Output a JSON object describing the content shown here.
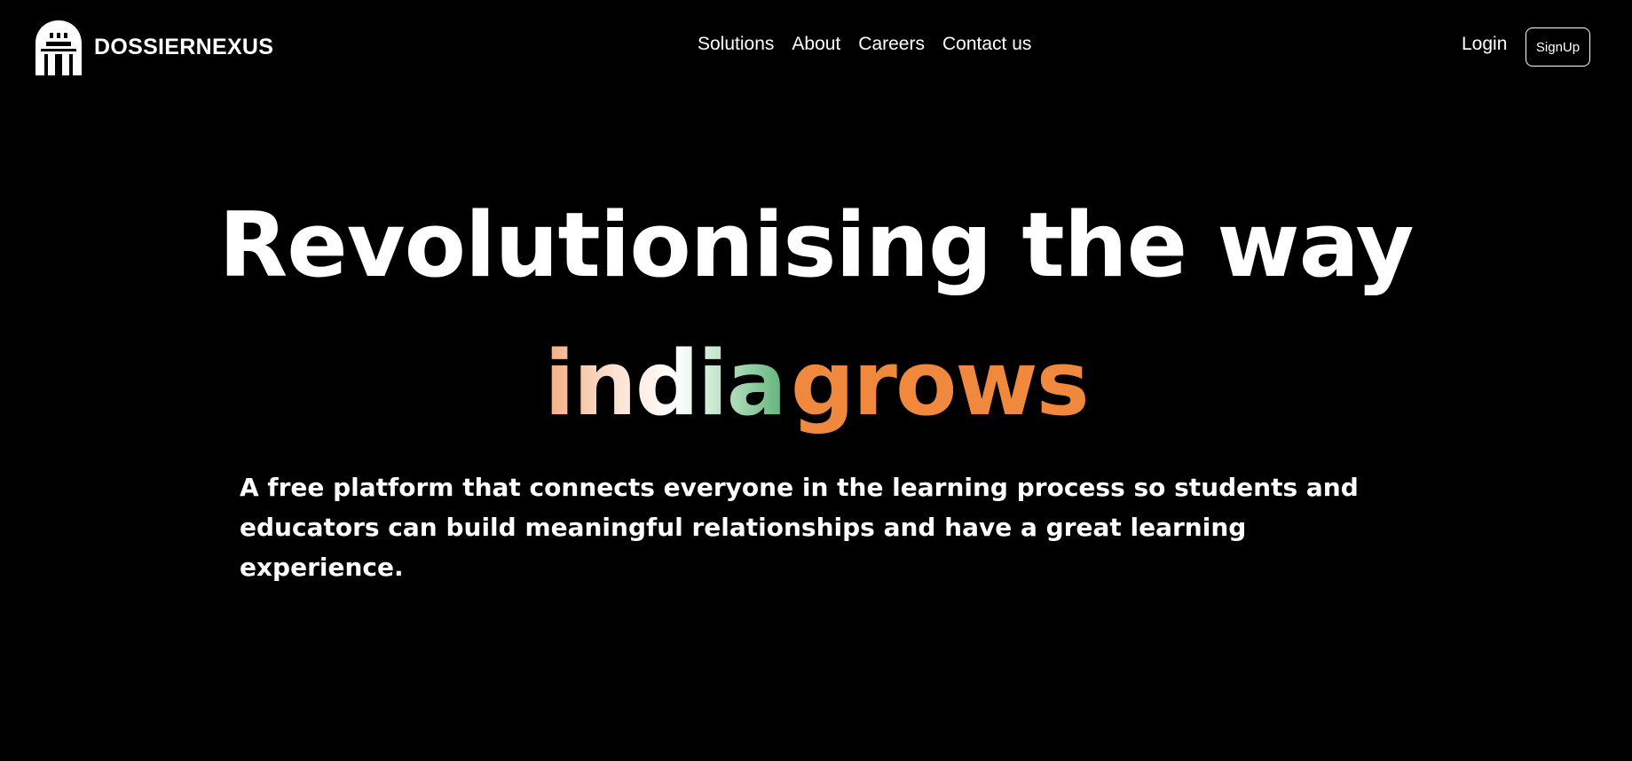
{
  "brand": {
    "name": "DOSSIERNEXUS",
    "logo_icon": "castle-gate-logo-icon"
  },
  "nav": {
    "items": [
      {
        "label": "Solutions"
      },
      {
        "label": "About"
      },
      {
        "label": "Careers"
      },
      {
        "label": "Contact us"
      }
    ],
    "login_label": "Login",
    "signup_label": "SignUp"
  },
  "hero": {
    "title": "Revolutionising the way",
    "tagline_part1": "india",
    "tagline_part2": "grows",
    "description": "A free platform that connects everyone in the learning process so students and educators can build meaningful relationships and have a great learning experience."
  },
  "colors": {
    "background": "#000000",
    "text": "#ffffff",
    "accent_orange": "#f0893e",
    "accent_green": "#5fb27a",
    "accent_peach": "#f2ad80"
  }
}
